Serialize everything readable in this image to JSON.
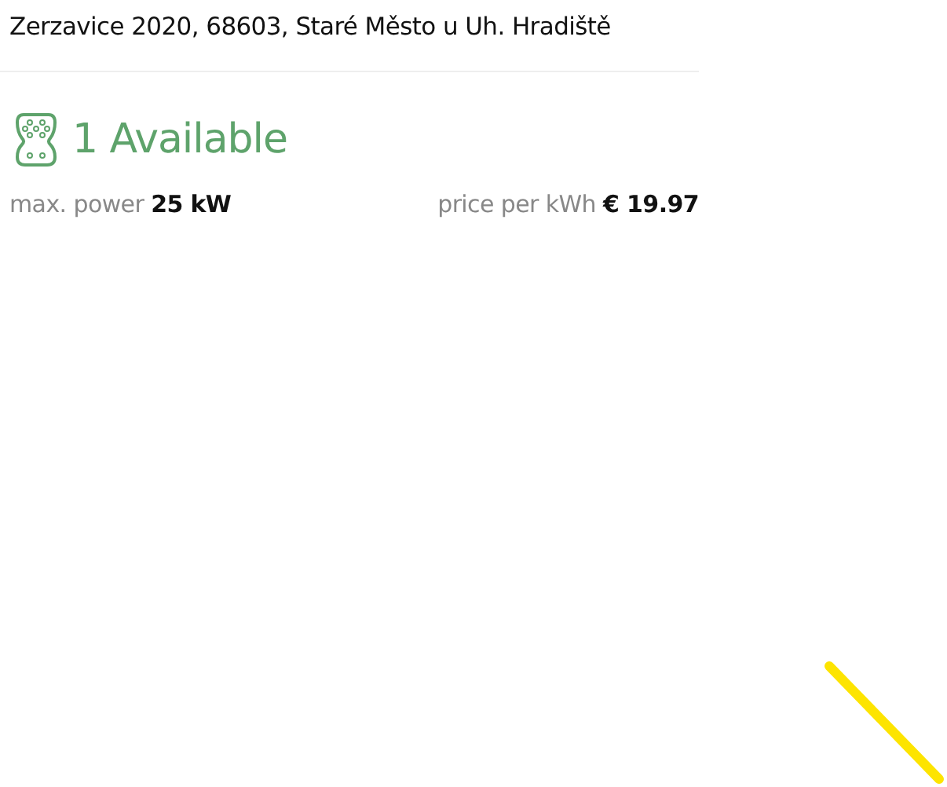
{
  "address": "Zerzavice 2020, 68603, Staré Město u Uh. Hradiště",
  "availability": {
    "text": "1 Available",
    "available": true
  },
  "specs": [
    "max. power **25 kW**",
    "price per kWh **€ 19.97**"
  ]
}
